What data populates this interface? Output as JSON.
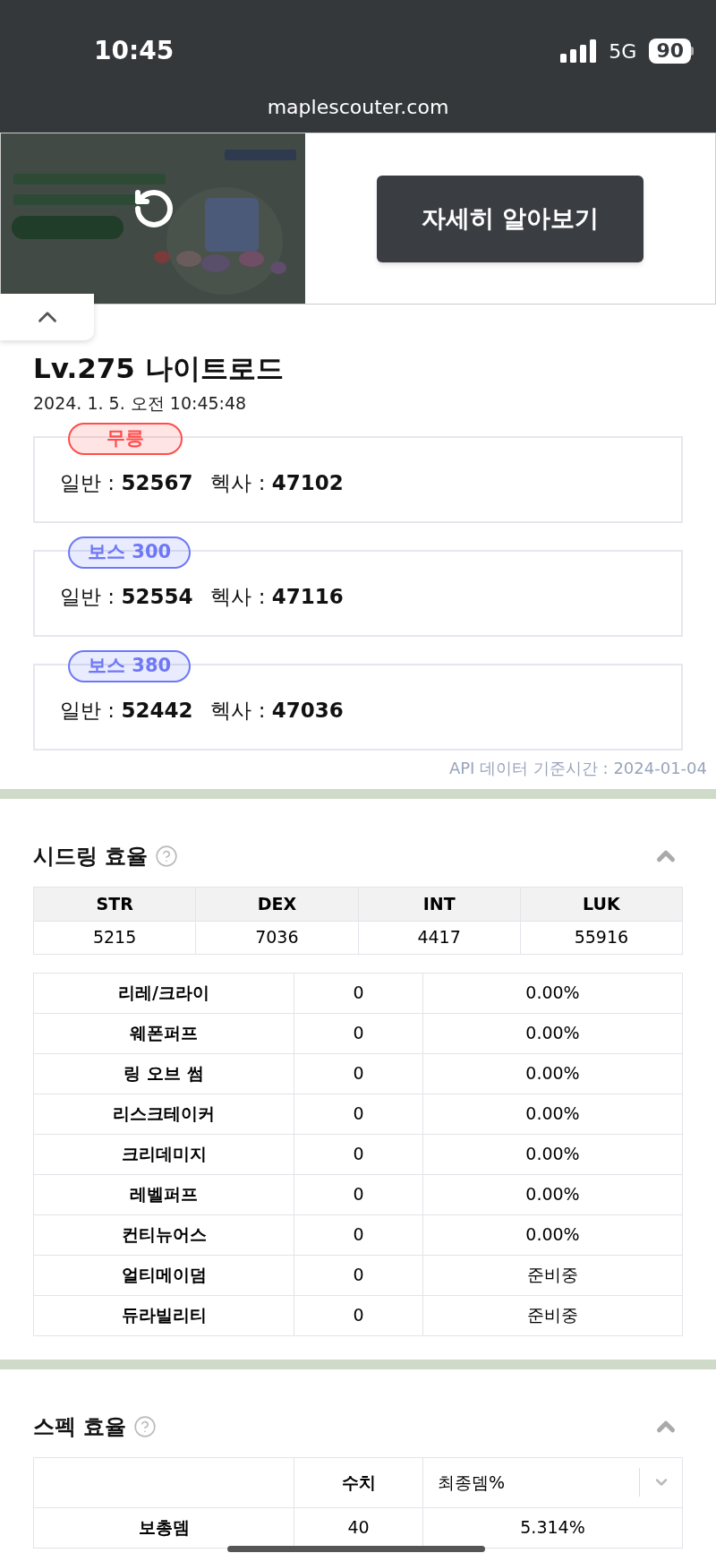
{
  "status_bar": {
    "time": "10:45",
    "network": "5G",
    "battery": "90"
  },
  "browser": {
    "url": "maplescouter.com"
  },
  "ad": {
    "kind": "picture",
    "button": "자세히 알아보기"
  },
  "character": {
    "title": "Lv.275 나이트로드",
    "timestamp": "2024. 1. 5. 오전 10:45:48"
  },
  "damage_cards": [
    {
      "tag": "무릉",
      "color": "#ff4d4d",
      "normal_label": "일반 :",
      "normal_value": "52567",
      "hexa_label": "헥사 :",
      "hexa_value": "47102"
    },
    {
      "tag": "보스 300",
      "color": "#6e78f5",
      "normal_label": "일반 :",
      "normal_value": "52554",
      "hexa_label": "헥사 :",
      "hexa_value": "47116"
    },
    {
      "tag": "보스 380",
      "color": "#6e78f5",
      "normal_label": "일반 :",
      "normal_value": "52442",
      "hexa_label": "헥사 :",
      "hexa_value": "47036"
    }
  ],
  "api_note": "API 데이터 기준시간 : 2024-01-04",
  "seeding": {
    "title": "시드링 효율",
    "expanded": true,
    "stats": {
      "columns": [
        "STR",
        "DEX",
        "INT",
        "LUK"
      ],
      "values": [
        "5215",
        "7036",
        "4417",
        "55916"
      ]
    },
    "rows": [
      {
        "name": "리레/크라이",
        "value": "0",
        "result": "0.00%"
      },
      {
        "name": "웨폰퍼프",
        "value": "0",
        "result": "0.00%"
      },
      {
        "name": "링 오브 썸",
        "value": "0",
        "result": "0.00%"
      },
      {
        "name": "리스크테이커",
        "value": "0",
        "result": "0.00%"
      },
      {
        "name": "크리데미지",
        "value": "0",
        "result": "0.00%"
      },
      {
        "name": "레벨퍼프",
        "value": "0",
        "result": "0.00%"
      },
      {
        "name": "컨티뉴어스",
        "value": "0",
        "result": "0.00%"
      },
      {
        "name": "얼티메이덤",
        "value": "0",
        "result": "준비중"
      },
      {
        "name": "듀라빌리티",
        "value": "0",
        "result": "준비중"
      }
    ]
  },
  "spec": {
    "title": "스펙 효율",
    "expanded": true,
    "value_column": "수치",
    "select": "최종뎀%",
    "rows": [
      {
        "name": "보총뎀",
        "value": "40",
        "result": "5.314%"
      }
    ]
  }
}
